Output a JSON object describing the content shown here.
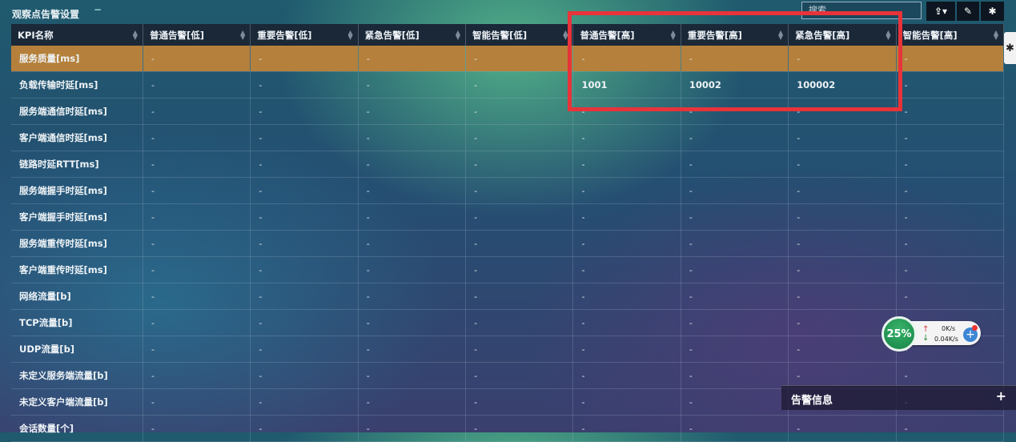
{
  "header": {
    "title": "观察点告警设置",
    "collapse_glyph": "−",
    "search_placeholder": "搜索",
    "export_icon_glyph": "⇪▾",
    "edit_icon_glyph": "✎",
    "settings_icon_glyph": "✱",
    "side_tab_glyph": "✱"
  },
  "table": {
    "columns": [
      "KPI名称",
      "普通告警[低]",
      "重要告警[低]",
      "紧急告警[低]",
      "智能告警[低]",
      "普通告警[高]",
      "重要告警[高]",
      "紧急告警[高]",
      "智能告警[高]"
    ],
    "rows": [
      [
        "服务质量[ms]",
        "-",
        "-",
        "-",
        "-",
        "-",
        "-",
        "-",
        "-"
      ],
      [
        "负载传输时延[ms]",
        "-",
        "-",
        "-",
        "-",
        "1001",
        "10002",
        "100002",
        "-"
      ],
      [
        "服务端通信时延[ms]",
        "-",
        "-",
        "-",
        "-",
        "-",
        "-",
        "-",
        "-"
      ],
      [
        "客户端通信时延[ms]",
        "-",
        "-",
        "-",
        "-",
        "-",
        "-",
        "-",
        "-"
      ],
      [
        "链路时延RTT[ms]",
        "-",
        "-",
        "-",
        "-",
        "-",
        "-",
        "-",
        "-"
      ],
      [
        "服务端握手时延[ms]",
        "-",
        "-",
        "-",
        "-",
        "-",
        "-",
        "-",
        "-"
      ],
      [
        "客户端握手时延[ms]",
        "-",
        "-",
        "-",
        "-",
        "-",
        "-",
        "-",
        "-"
      ],
      [
        "服务端重传时延[ms]",
        "-",
        "-",
        "-",
        "-",
        "-",
        "-",
        "-",
        "-"
      ],
      [
        "客户端重传时延[ms]",
        "-",
        "-",
        "-",
        "-",
        "-",
        "-",
        "-",
        "-"
      ],
      [
        "网络流量[b]",
        "-",
        "-",
        "-",
        "-",
        "-",
        "-",
        "-",
        "-"
      ],
      [
        "TCP流量[b]",
        "-",
        "-",
        "-",
        "-",
        "-",
        "-",
        "-",
        "-"
      ],
      [
        "UDP流量[b]",
        "-",
        "-",
        "-",
        "-",
        "-",
        "-",
        "-",
        "-"
      ],
      [
        "未定义服务端流量[b]",
        "-",
        "-",
        "-",
        "-",
        "-",
        "-",
        "-",
        "-"
      ],
      [
        "未定义客户端流量[b]",
        "-",
        "-",
        "-",
        "-",
        "-",
        "-",
        "-",
        "-"
      ],
      [
        "会话数量[个]",
        "-",
        "-",
        "-",
        "-",
        "-",
        "-",
        "-",
        "-"
      ]
    ],
    "selected_row_index": 0,
    "selected_row_color": "#b5803b"
  },
  "speed_widget": {
    "percent": "25%",
    "upload": "0K/s",
    "download": "0.04K/s",
    "up_arrow": "↑",
    "down_arrow": "↓",
    "plus_glyph": "+"
  },
  "alert_panel": {
    "title": "告警信息",
    "plus_glyph": "+"
  },
  "colors": {
    "highlight_box": "#e8333a",
    "header_bg": "#1a2838"
  }
}
